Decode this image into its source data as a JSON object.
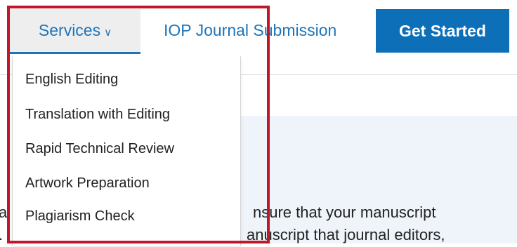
{
  "nav": {
    "services_label": "Services",
    "services_chevron_icon": "chevron-down-icon",
    "iop_label": "IOP Journal Submission",
    "get_started_label": "Get Started"
  },
  "dropdown": {
    "items": [
      {
        "label": "English Editing"
      },
      {
        "label": "Translation with Editing"
      },
      {
        "label": "Rapid Technical Review"
      },
      {
        "label": "Artwork Preparation"
      },
      {
        "label": "Plagiarism Check"
      }
    ]
  },
  "body": {
    "line1_start": "a",
    "line1_end": "nsure that your manuscript",
    "line2_start": ".",
    "line2_end": "anuscript that journal editors,"
  },
  "colors": {
    "link": "#1f74b8",
    "button": "#0d6fb8",
    "highlight": "#c0172a",
    "hero_bg": "#eef4fa"
  }
}
